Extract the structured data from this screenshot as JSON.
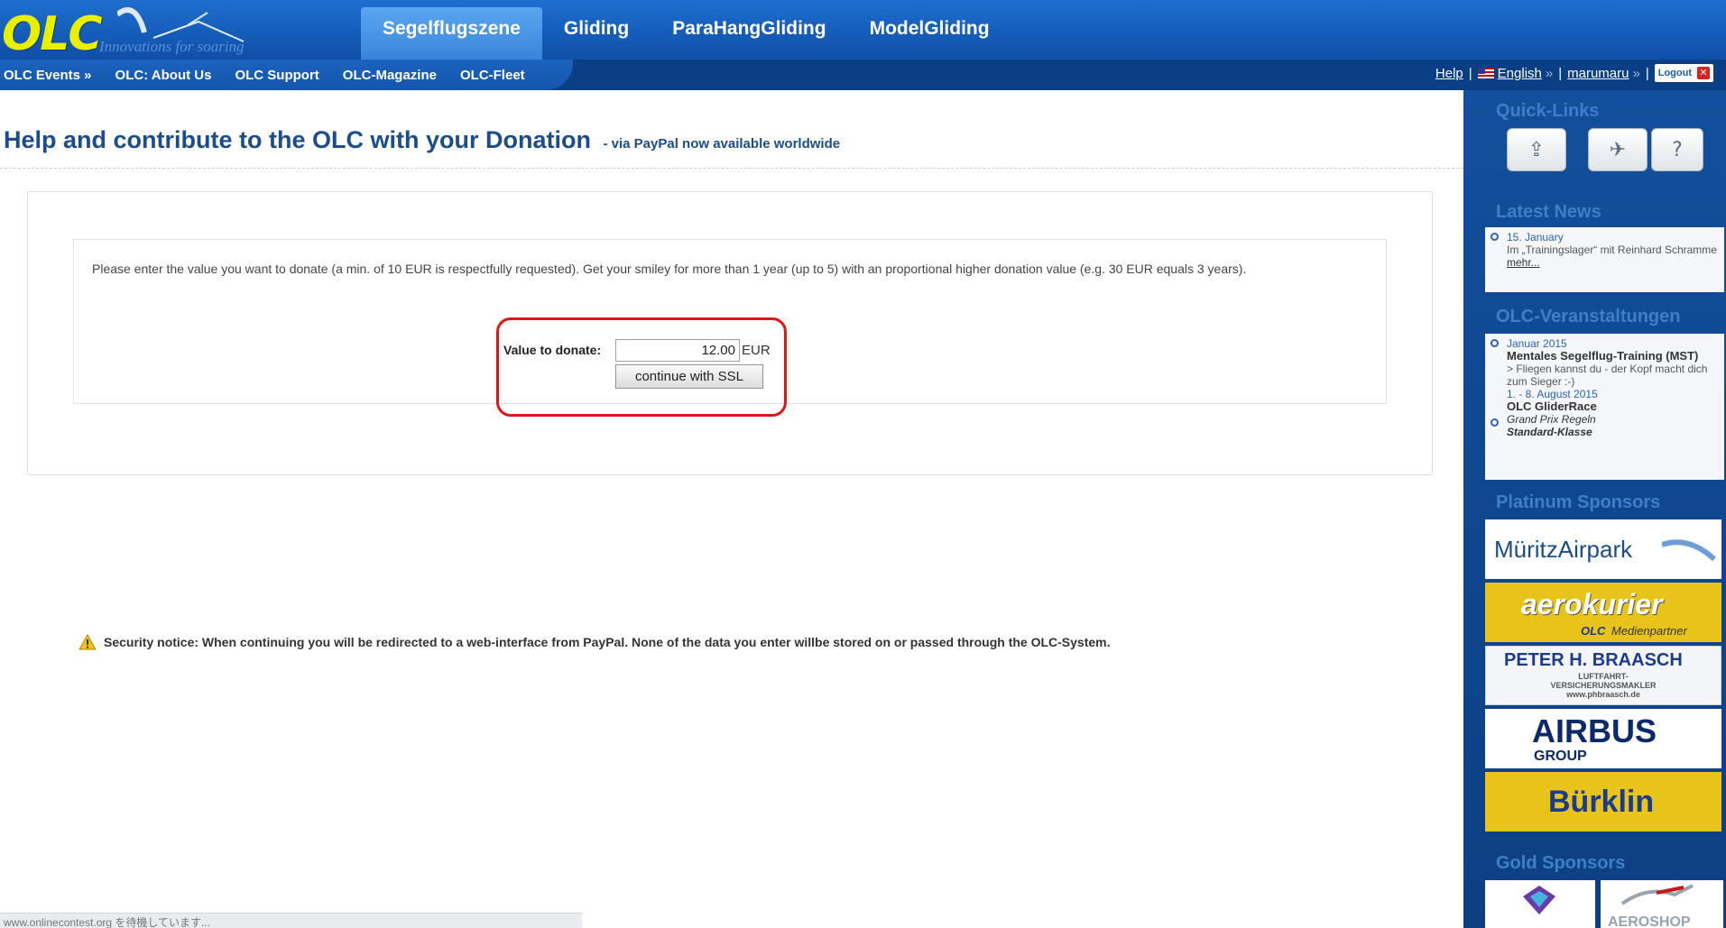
{
  "header": {
    "logo_text": "OLC",
    "tagline": "Innovations for soaring",
    "tabs": [
      {
        "label": "Segelflugszene",
        "active": true
      },
      {
        "label": "Gliding",
        "active": false
      },
      {
        "label": "ParaHangGliding",
        "active": false
      },
      {
        "label": "ModelGliding",
        "active": false
      }
    ]
  },
  "subnav": {
    "items": [
      "OLC Events »",
      "OLC: About Us",
      "OLC Support",
      "OLC-Magazine",
      "OLC-Fleet"
    ]
  },
  "toplinks": {
    "help": "Help",
    "language": "English",
    "language_arrow": "»",
    "user": "marumaru",
    "user_arrow": "»",
    "logout": "Logout"
  },
  "main": {
    "title": "Help and contribute to the OLC with your Donation",
    "subtitle": "- via PayPal now available worldwide",
    "intro": "Please enter the value you want to donate (a min. of 10 EUR is respectfully requested). Get your smiley for more than 1 year (up to 5) with an proportional higher donation value (e.g. 30 EUR equals 3 years).",
    "form": {
      "label": "Value to donate:",
      "value": "12.00",
      "currency": "EUR",
      "button": "continue with SSL"
    },
    "security_notice": "Security notice: When continuing you will be redirected to a web-interface from PayPal. None of the data you enter willbe stored on or passed through the OLC-System."
  },
  "statusbar": {
    "text": "www.onlinecontest.org を待機しています..."
  },
  "sidebar": {
    "quick_links_title": "Quick-Links",
    "latest_news_title": "Latest News",
    "news": {
      "date": "15. January",
      "text": "Im „Trainingslager“ mit Reinhard Schramme",
      "more": "mehr..."
    },
    "events_title": "OLC-Veranstaltungen",
    "events": [
      {
        "date": "Januar 2015",
        "title": "Mentales Segelflug-Training (MST)",
        "desc": "> Fliegen kannst du - der Kopf macht dich zum Sieger :-)"
      },
      {
        "date": "1. - 8. August 2015",
        "title": "OLC GliderRace",
        "line1": "Grand Prix Regeln",
        "line2": "Standard-Klasse"
      }
    ],
    "platinum_title": "Platinum Sponsors",
    "sponsors": {
      "mueritz": "MüritzAirpark",
      "aero": "aerokurier",
      "aero_sub_brand": "OLC",
      "aero_sub": "Medienpartner",
      "braasch": "PETER H. BRAASCH",
      "braasch_l1": "LUFTFAHRT-",
      "braasch_l2": "VERSICHERUNGSMAKLER",
      "braasch_l3": "www.phbraasch.de",
      "airbus": "AIRBUS",
      "airbus_sub": "GROUP",
      "buerklin": "Bürklin"
    },
    "gold_title": "Gold Sponsors",
    "gold_2": "AEROSHOP"
  },
  "colors": {
    "header_blue": "#1560c0",
    "title_blue": "#1b4c8c",
    "highlight_red": "#e01616",
    "sponsor_yellow": "#e8c41a"
  }
}
